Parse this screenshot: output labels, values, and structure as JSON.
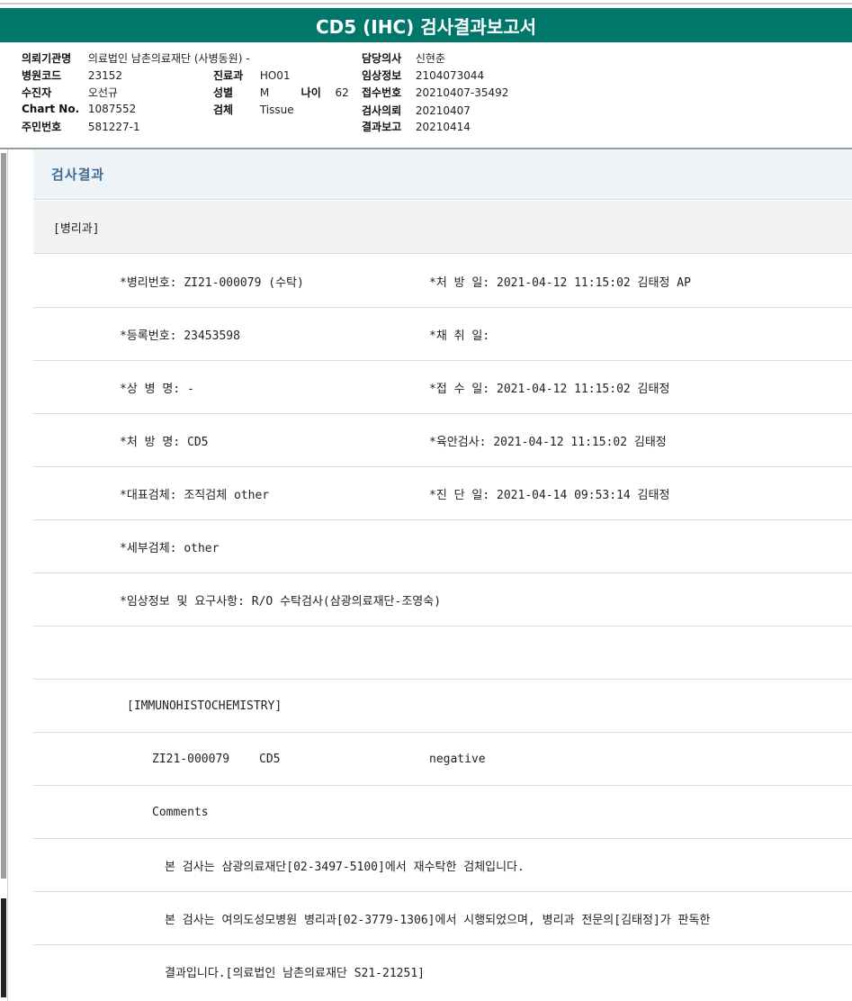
{
  "report": {
    "title": "CD5 (IHC) 검사결과보고서"
  },
  "info": {
    "institution_label": "의뢰기관명",
    "institution": "의료법인 남촌의료재단 (사병동원) -",
    "hospital_code_label": "병원코드",
    "hospital_code": "23152",
    "collector_label": "수진자",
    "collector": "오선규",
    "chart_no_label": "Chart No.",
    "chart_no": "1087552",
    "resident_no_label": "주민번호",
    "resident_no": "581227-1",
    "dept_label": "진료과",
    "dept": "HO01",
    "sex_label": "성별",
    "sex": "M",
    "age_label": "나이",
    "age": "62",
    "specimen_label": "검체",
    "specimen": "Tissue",
    "doctor_label": "담당의사",
    "doctor": "신현춘",
    "clinical_label": "임상정보",
    "clinical": "2104073044",
    "receipt_label": "접수번호",
    "receipt": "20210407-35492",
    "request_label": "검사의뢰",
    "request": "20210407",
    "report_label": "결과보고",
    "report_date": "20210414"
  },
  "result": {
    "section_title": "검사결과",
    "department": "[병리과]",
    "rows": [
      {
        "left": "*병리번호: ZI21-000079 (수탁)",
        "right": "*처 방 일: 2021-04-12 11:15:02  김태정 AP"
      },
      {
        "left": "*등록번호: 23453598",
        "right": "*채 취 일:"
      },
      {
        "left": "*상 병 명: -",
        "right": "*접 수 일: 2021-04-12 11:15:02  김태정"
      },
      {
        "left": "*처 방 명: CD5",
        "right": "*육안검사: 2021-04-12 11:15:02  김태정"
      },
      {
        "left": "*대표검체: 조직검체 other",
        "right": "*진 단 일: 2021-04-14 09:53:14  김태정"
      },
      {
        "left": "*세부검체: other",
        "right": ""
      },
      {
        "left": "*임상정보 및 요구사항: R/O 수탁검사(삼광의료재단-조영숙)",
        "right": ""
      },
      {
        "left": "",
        "right": ""
      },
      {
        "left": "[IMMUNOHISTOCHEMISTRY]",
        "right": ""
      },
      {
        "left": "ZI21-000079",
        "mid": "CD5",
        "right": "negative"
      },
      {
        "left": "Comments",
        "right": ""
      },
      {
        "left": "본 검사는 삼광의료재단[02-3497-5100]에서 재수탁한 검체입니다.",
        "right": ""
      },
      {
        "left": "본 검사는 여의도성모병원 병리과[02-3779-1306]에서 시행되었으며, 병리과 전문의[김태정]가 판독한",
        "right": ""
      },
      {
        "left": "결과입니다.[의료법인 남촌의료재단 S21-21251]",
        "right": ""
      }
    ]
  }
}
